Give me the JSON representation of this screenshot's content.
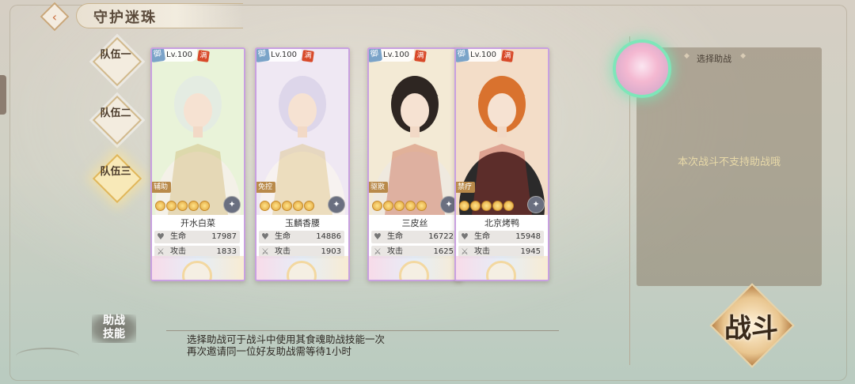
{
  "header": {
    "title": "守护迷珠",
    "back_icon": "back-arrow-icon"
  },
  "teams": [
    {
      "label": "队伍一",
      "active": false
    },
    {
      "label": "队伍二",
      "active": false
    },
    {
      "label": "队伍三",
      "active": true
    }
  ],
  "cards": [
    {
      "level": "Lv.100",
      "tag": "御",
      "full": "满",
      "role": "辅助",
      "name": "开水白菜",
      "hp_label": "生命",
      "hp": "17987",
      "atk_label": "攻击",
      "atk": "1833",
      "colors": {
        "hair": "#e4ece2",
        "outfit": "#f4f1e8",
        "accent": "#c8a85a",
        "bg": "#e9f3d9"
      }
    },
    {
      "level": "Lv.100",
      "tag": "御",
      "full": "满",
      "role": "免控",
      "name": "玉麟香腰",
      "hp_label": "生命",
      "hp": "14886",
      "atk_label": "攻击",
      "atk": "1903",
      "colors": {
        "hair": "#ddd6ea",
        "outfit": "#f7f2f0",
        "accent": "#d8b860",
        "bg": "#efe8f3"
      }
    },
    {
      "level": "Lv.100",
      "tag": "御",
      "full": "满",
      "role": "驱散",
      "name": "三皮丝",
      "hp_label": "生命",
      "hp": "16722",
      "atk_label": "攻击",
      "atk": "1625",
      "colors": {
        "hair": "#2e2622",
        "outfit": "#efe9df",
        "accent": "#c0482a",
        "bg": "#f3ead5"
      }
    },
    {
      "level": "Lv.100",
      "tag": "御",
      "full": "满",
      "role": "禁疗",
      "name": "北京烤鸭",
      "hp_label": "生命",
      "hp": "15948",
      "atk_label": "攻击",
      "atk": "1945",
      "colors": {
        "hair": "#d9722e",
        "outfit": "#2b2a2a",
        "accent": "#b8352a",
        "bg": "#f3ddc8"
      }
    }
  ],
  "assist": {
    "title": "选择助战",
    "message": "本次战斗不支持助战哦"
  },
  "skill": {
    "label_line1": "助战",
    "label_line2": "技能",
    "desc_line1": "选择助战可于战斗中使用其食魂助战技能一次",
    "desc_line2": "再次邀请同一位好友助战需等待1小时"
  },
  "fight_button": {
    "label": "战斗"
  }
}
